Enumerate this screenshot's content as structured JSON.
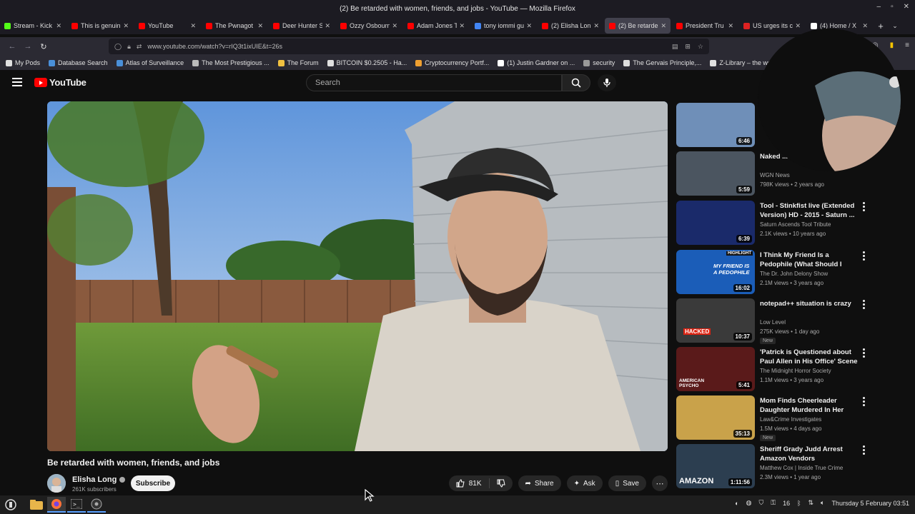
{
  "window": {
    "title": "(2) Be retarded with women, friends, and jobs - YouTube — Mozilla Firefox",
    "controls": [
      "–",
      "▫",
      "✕"
    ]
  },
  "tabs": [
    {
      "label": "Stream - Kick",
      "color": "#53fc18",
      "active": false
    },
    {
      "label": "This is genuin",
      "color": "#ff0000",
      "active": false
    },
    {
      "label": "YouTube",
      "color": "#ff0000",
      "active": false
    },
    {
      "label": "The Pwnagot",
      "color": "#ff0000",
      "active": false
    },
    {
      "label": "Deer Hunter S",
      "color": "#ff0000",
      "active": false
    },
    {
      "label": "Ozzy Osbourn",
      "color": "#ff0000",
      "active": false
    },
    {
      "label": "Adam Jones T",
      "color": "#ff0000",
      "active": false
    },
    {
      "label": "tony iommi gu",
      "color": "#4285f4",
      "active": false
    },
    {
      "label": "(2) Elisha Lon",
      "color": "#ff0000",
      "active": false
    },
    {
      "label": "(2) Be retarde",
      "color": "#ff0000",
      "active": true
    },
    {
      "label": "President Tru",
      "color": "#ff0000",
      "active": false
    },
    {
      "label": "US urges its c",
      "color": "#d22",
      "active": false
    },
    {
      "label": "(4) Home / X",
      "color": "#ffffff",
      "active": false
    }
  ],
  "navbar": {
    "url": "www.youtube.com/watch?v=rIQ3t1ixUIE&t=26s"
  },
  "bookmarks": [
    {
      "label": "My Pods",
      "color": "#e0e0e0"
    },
    {
      "label": "Database Search",
      "color": "#4a90d9"
    },
    {
      "label": "Atlas of Surveillance",
      "color": "#4a90d9"
    },
    {
      "label": "The Most Prestigious ...",
      "color": "#bbbbbb"
    },
    {
      "label": "The Forum",
      "color": "#f0c040"
    },
    {
      "label": "BITCOIN $0.2505 - Ha...",
      "color": "#e0e0e0"
    },
    {
      "label": "Cryptocurrency Portf...",
      "color": "#f0a030"
    },
    {
      "label": "(1) Justin Gardner on ...",
      "color": "#ffffff"
    },
    {
      "label": "security",
      "color": "#999999"
    },
    {
      "label": "The Gervais Principle,...",
      "color": "#dddddd"
    },
    {
      "label": "Z-Library – the world'...",
      "color": "#e0e0e0"
    }
  ],
  "youtube": {
    "logo": "YouTube",
    "search_placeholder": "Search"
  },
  "video": {
    "title": "Be retarded with women, friends, and jobs",
    "channel": "Elisha Long",
    "subscribers": "261K subscribers",
    "subscribe_label": "Subscribe",
    "likes": "81K",
    "share_label": "Share",
    "ask_label": "Ask",
    "save_label": "Save"
  },
  "recommendations": [
    {
      "title": "",
      "channel": "",
      "meta": "",
      "duration": "6:46",
      "new": false,
      "thumb": "#6f8fb8"
    },
    {
      "title": "Naked ... in indecency",
      "channel": "WGN News",
      "meta": "798K views • 2 years ago",
      "duration": "5:59",
      "new": false,
      "thumb": "#4b5560"
    },
    {
      "title": "Tool - Stinkfist live (Extended Version) HD - 2015 - Saturn ...",
      "channel": "Saturn Ascends Tool Tribute",
      "meta": "2.1K views • 10 years ago",
      "duration": "6:39",
      "new": false,
      "thumb": "#1a2a6a"
    },
    {
      "title": "I Think My Friend Is a Pedophile (What Should I Do?)",
      "channel": "The Dr. John Delony Show",
      "meta": "2.1M views • 3 years ago",
      "duration": "16:02",
      "new": false,
      "thumb": "#1b5db8"
    },
    {
      "title": "notepad++ situation is crazy",
      "channel": "Low Level",
      "meta": "275K views • 1 day ago",
      "duration": "10:37",
      "new": true,
      "thumb": "#3a3a3a"
    },
    {
      "title": "'Patrick is Questioned about Paul Allen in His Office' Scene ...",
      "channel": "The Midnight Horror Society",
      "meta": "1.1M views • 3 years ago",
      "duration": "5:41",
      "new": false,
      "thumb": "#5a1a1a"
    },
    {
      "title": "Mom Finds Cheerleader Daughter Murdered In Her Ow...",
      "channel": "Law&Crime Investigates",
      "meta": "1.5M views • 4 days ago",
      "duration": "35:13",
      "new": true,
      "thumb": "#c9a24a"
    },
    {
      "title": "Sheriff Grady Judd Arrest Amazon Vendors",
      "channel": "Matthew Cox | Inside True Crime",
      "meta": "2.3M views • 1 year ago",
      "duration": "1:11:56",
      "new": false,
      "thumb": "#2c3e50"
    }
  ],
  "labels": {
    "new_badge": "New",
    "highlight": "HIGHLIGHT",
    "friend_text": "MY FRIEND IS A PEDOPHILE",
    "hacked": "HACKED",
    "psycho": "AMERICAN PSYCHO",
    "amazon": "AMAZON"
  },
  "taskbar": {
    "tray_count": "16",
    "date": "Thursday  5 February 03:51"
  }
}
